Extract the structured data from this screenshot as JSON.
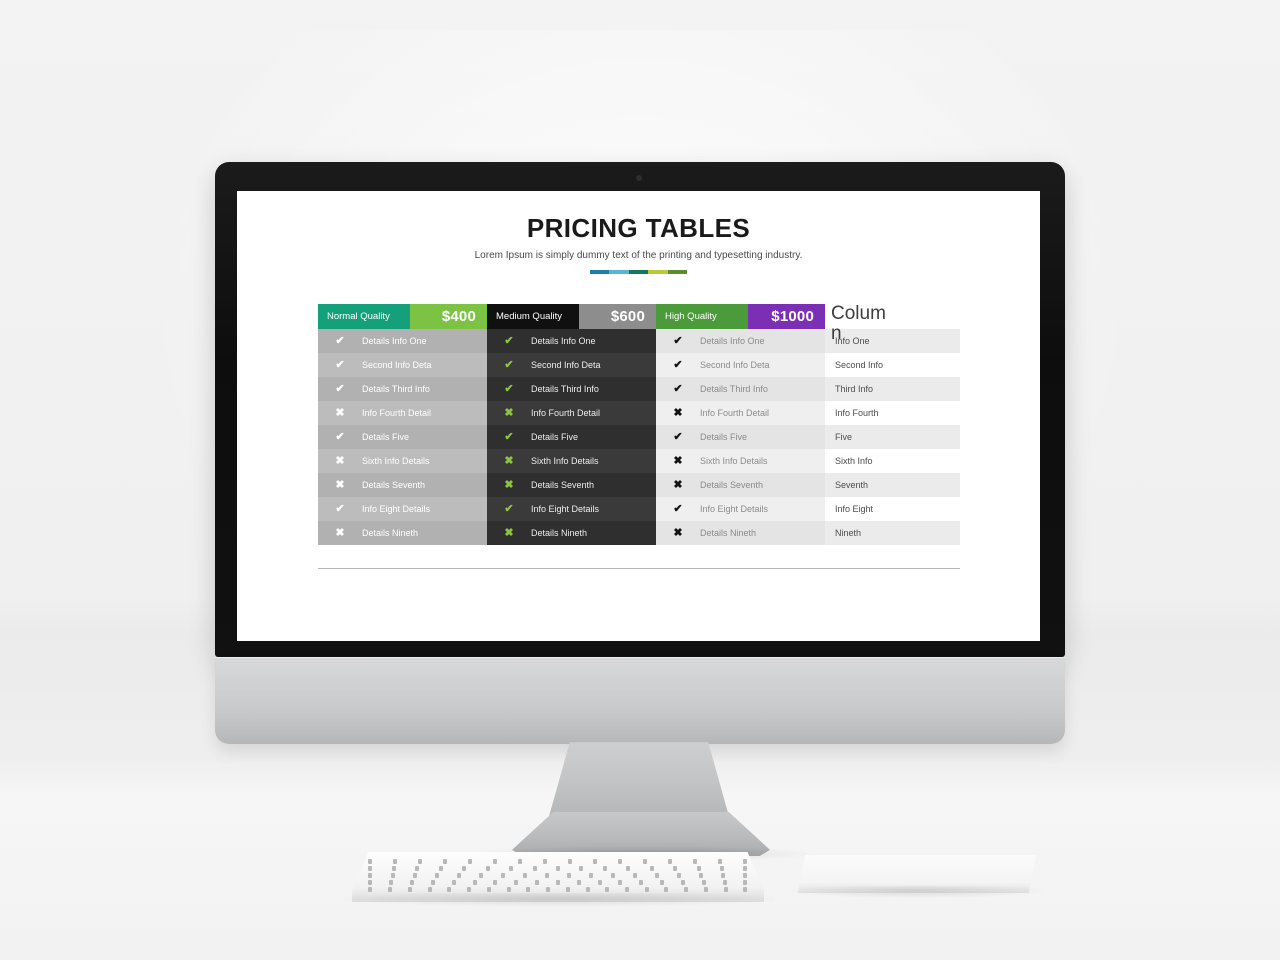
{
  "slide": {
    "title": "PRICING TABLES",
    "subtitle": "Lorem Ipsum is simply dummy text of the printing and typesetting industry.",
    "accent_segments": [
      "#1d7fa8",
      "#58b4d1",
      "#12795e",
      "#bcc83a",
      "#5d8c2f"
    ]
  },
  "columns": [
    {
      "id": "normal",
      "name_label": "Normal Quality",
      "price_label": "$400",
      "name_bg": "#14a07a",
      "price_bg": "#7cc243",
      "rows": [
        {
          "mark": "check",
          "label": "Details Info One"
        },
        {
          "mark": "check",
          "label": "Second Info Deta"
        },
        {
          "mark": "check",
          "label": "Details Third Info"
        },
        {
          "mark": "cross",
          "label": "Info Fourth Detail"
        },
        {
          "mark": "check",
          "label": "Details Five"
        },
        {
          "mark": "cross",
          "label": "Sixth Info Details"
        },
        {
          "mark": "cross",
          "label": "Details Seventh"
        },
        {
          "mark": "check",
          "label": "Info Eight Details"
        },
        {
          "mark": "cross",
          "label": "Details Nineth"
        }
      ]
    },
    {
      "id": "medium",
      "name_label": "Medium Quality",
      "price_label": "$600",
      "name_bg": "#101010",
      "price_bg": "#8d8d8d",
      "rows": [
        {
          "mark": "check",
          "label": "Details Info One"
        },
        {
          "mark": "check",
          "label": "Second Info Deta"
        },
        {
          "mark": "check",
          "label": "Details Third Info"
        },
        {
          "mark": "cross",
          "label": "Info Fourth Detail"
        },
        {
          "mark": "check",
          "label": "Details Five"
        },
        {
          "mark": "cross",
          "label": "Sixth Info Details"
        },
        {
          "mark": "cross",
          "label": "Details Seventh"
        },
        {
          "mark": "check",
          "label": "Info Eight Details"
        },
        {
          "mark": "cross",
          "label": "Details Nineth"
        }
      ]
    },
    {
      "id": "high",
      "name_label": "High Quality",
      "price_label": "$1000",
      "name_bg": "#4c9b3a",
      "price_bg": "#7b2fb5",
      "rows": [
        {
          "mark": "check",
          "label": "Details Info One"
        },
        {
          "mark": "check",
          "label": "Second Info Deta"
        },
        {
          "mark": "check",
          "label": "Details Third Info"
        },
        {
          "mark": "cross",
          "label": "Info Fourth Detail"
        },
        {
          "mark": "check",
          "label": "Details Five"
        },
        {
          "mark": "cross",
          "label": "Sixth Info Details"
        },
        {
          "mark": "cross",
          "label": "Details Seventh"
        },
        {
          "mark": "check",
          "label": "Info Eight Details"
        },
        {
          "mark": "cross",
          "label": "Details Nineth"
        }
      ]
    }
  ],
  "plain_column": {
    "header_label": "Column",
    "rows": [
      {
        "label": "Info One"
      },
      {
        "label": "Second Info"
      },
      {
        "label": "Third Info"
      },
      {
        "label": "Info Fourth"
      },
      {
        "label": "Five"
      },
      {
        "label": "Sixth Info"
      },
      {
        "label": "Seventh"
      },
      {
        "label": "Info Eight"
      },
      {
        "label": "Nineth"
      }
    ]
  },
  "glyphs": {
    "check": "✔",
    "cross": "✖"
  }
}
